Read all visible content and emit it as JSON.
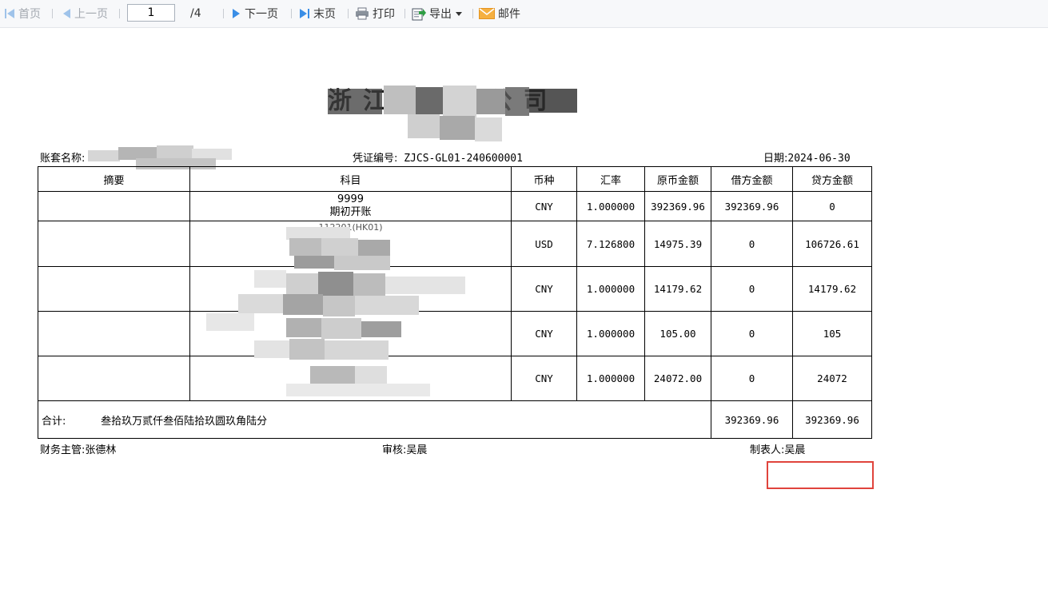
{
  "toolbar": {
    "first_page": "首页",
    "prev_page": "上一页",
    "current_page": "1",
    "total_pages": "/4",
    "next_page": "下一页",
    "last_page": "末页",
    "print": "打印",
    "export": "导出",
    "mail": "邮件"
  },
  "voucher": {
    "title": "浙江 有限公司",
    "ledger_label": "账套名称:",
    "voucher_no_label": "凭证编号:",
    "voucher_no": "ZJCS-GL01-240600001",
    "date_label": "日期:",
    "date": "2024-06-30",
    "columns": [
      "摘要",
      "科目",
      "币种",
      "汇率",
      "原币金额",
      "借方金额",
      "贷方金额"
    ],
    "rows": [
      {
        "summary": "",
        "account_code": "9999",
        "account_name": "期初开账",
        "currency": "CNY",
        "rate": "1.000000",
        "original": "392369.96",
        "debit": "392369.96",
        "credit": "0"
      },
      {
        "summary": "",
        "account_code": "112201(HK01)",
        "account_name": "",
        "currency": "USD",
        "rate": "7.126800",
        "original": "14975.39",
        "debit": "0",
        "credit": "106726.61"
      },
      {
        "summary": "",
        "account_code": "",
        "account_name": "",
        "currency": "CNY",
        "rate": "1.000000",
        "original": "14179.62",
        "debit": "0",
        "credit": "14179.62"
      },
      {
        "summary": "",
        "account_code": "",
        "account_name": "",
        "currency": "CNY",
        "rate": "1.000000",
        "original": "105.00",
        "debit": "0",
        "credit": "105"
      },
      {
        "summary": "",
        "account_code": "",
        "account_name": "",
        "currency": "CNY",
        "rate": "1.000000",
        "original": "24072.00",
        "debit": "0",
        "credit": "24072"
      }
    ],
    "total_label": "合计:",
    "total_in_words": "叁拾玖万贰仟叁佰陆拾玖圆玖角陆分",
    "total_debit": "392369.96",
    "total_credit": "392369.96",
    "supervisor_label": "财务主管:",
    "supervisor": "张德林",
    "auditor_label": "审核:",
    "auditor": "吴晨",
    "preparer_label": "制表人:",
    "preparer": "吴晨"
  },
  "colors": {
    "toolbar_icon_blue": "#3a8ee6",
    "export_icon_green": "#2f9e44",
    "mail_icon_orange": "#f0a030",
    "highlight_red": "#e0443c"
  },
  "icons": [
    "first-page-icon",
    "prev-page-icon",
    "next-page-icon",
    "last-page-icon",
    "print-icon",
    "export-icon",
    "dropdown-caret-icon",
    "mail-icon"
  ]
}
